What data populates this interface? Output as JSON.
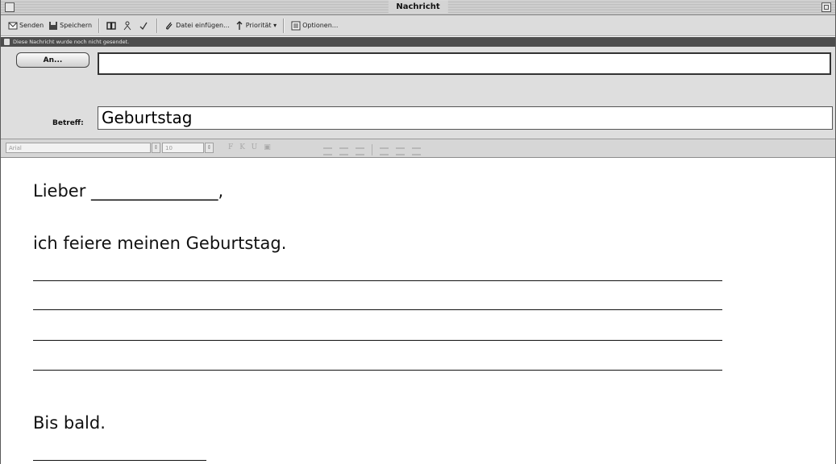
{
  "window": {
    "title": "Nachricht"
  },
  "toolbar": {
    "send_label": "Senden",
    "save_label": "Speichern",
    "attach_label": "Datei einfügen...",
    "priority_label": "Priorität ▾",
    "options_label": "Optionen..."
  },
  "status": {
    "text": "Diese Nachricht wurde noch nicht gesendet."
  },
  "header": {
    "to_button_label": "An...",
    "to_value": "",
    "subject_label": "Betreff:",
    "subject_value": "Geburtstag"
  },
  "format": {
    "font_value": "Arial",
    "size_value": "10"
  },
  "body": {
    "greeting": "Lieber _______________,",
    "line1": "ich feiere meinen Geburtstag.",
    "closing": "Bis bald."
  }
}
